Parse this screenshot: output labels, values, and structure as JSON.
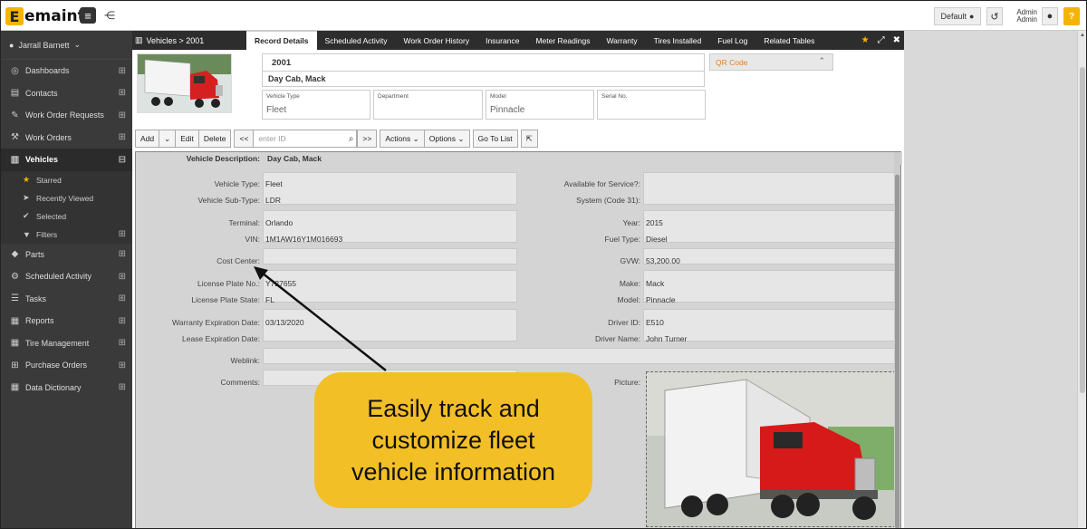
{
  "app": {
    "logo_text": "emaint",
    "logo_mark": "E"
  },
  "topbar": {
    "default_label": "Default",
    "admin_line1": "Admin",
    "admin_line2": "Admin",
    "help": "?"
  },
  "sidebar": {
    "user": "Jarrall Barnett",
    "items": [
      {
        "label": "Dashboards",
        "icon": "dashboard-icon",
        "glyph": "◎"
      },
      {
        "label": "Contacts",
        "icon": "contacts-icon",
        "glyph": "▤"
      },
      {
        "label": "Work Order Requests",
        "icon": "wrench-icon",
        "glyph": "✎"
      },
      {
        "label": "Work Orders",
        "icon": "wrench-icon",
        "glyph": "⚒"
      },
      {
        "label": "Vehicles",
        "icon": "vehicles-icon",
        "glyph": "▥"
      }
    ],
    "sub_items": [
      {
        "label": "Starred",
        "icon": "star-icon",
        "glyph": "★"
      },
      {
        "label": "Recently Viewed",
        "icon": "send-icon",
        "glyph": "➤"
      },
      {
        "label": "Selected",
        "icon": "check-icon",
        "glyph": "✔"
      },
      {
        "label": "Filters",
        "icon": "filter-icon",
        "glyph": "▼"
      }
    ],
    "items2": [
      {
        "label": "Parts",
        "icon": "tag-icon",
        "glyph": "◆"
      },
      {
        "label": "Scheduled Activity",
        "icon": "gears-icon",
        "glyph": "⚙"
      },
      {
        "label": "Tasks",
        "icon": "tasks-icon",
        "glyph": "☰"
      },
      {
        "label": "Reports",
        "icon": "chart-icon",
        "glyph": "▦"
      },
      {
        "label": "Tire Management",
        "icon": "table-icon",
        "glyph": "▦"
      },
      {
        "label": "Purchase Orders",
        "icon": "cart-icon",
        "glyph": "⊞"
      },
      {
        "label": "Data Dictionary",
        "icon": "table-icon",
        "glyph": "▦"
      }
    ]
  },
  "tabbar": {
    "breadcrumb": "Vehicles > 2001",
    "tabs": [
      "Record Details",
      "Scheduled Activity",
      "Work Order History",
      "Insurance",
      "Meter Readings",
      "Warranty",
      "Tires Installed",
      "Fuel Log",
      "Related Tables"
    ]
  },
  "header": {
    "id": "2001",
    "name": "Day Cab, Mack",
    "qr": "QR Code",
    "fields": [
      {
        "label": "Vehicle Type",
        "value": "Fleet"
      },
      {
        "label": "Department",
        "value": ""
      },
      {
        "label": "Model",
        "value": "Pinnacle"
      },
      {
        "label": "Serial No.",
        "value": ""
      }
    ]
  },
  "toolbar": {
    "add": "Add",
    "edit": "Edit",
    "delete": "Delete",
    "prev": "<<",
    "search_placeholder": "enter ID",
    "next": ">>",
    "actions": "Actions",
    "options": "Options",
    "goto": "Go To List"
  },
  "form": {
    "description_label": "Vehicle Description:",
    "description_value": "Day Cab, Mack",
    "left": [
      {
        "label": "Vehicle Type:",
        "value": "Fleet"
      },
      {
        "label": "Vehicle Sub-Type:",
        "value": "LDR"
      },
      {
        "label": "Terminal:",
        "value": "Orlando"
      },
      {
        "label": "VIN:",
        "value": "1M1AW16Y1M016693"
      },
      {
        "label": "Cost Center:",
        "value": ""
      },
      {
        "label": "License Plate No.:",
        "value": "Y727655"
      },
      {
        "label": "License Plate State:",
        "value": "FL"
      },
      {
        "label": "Warranty Expiration Date:",
        "value": "03/13/2020"
      },
      {
        "label": "Lease Expiration Date:",
        "value": ""
      },
      {
        "label": "Weblink:",
        "value": ""
      },
      {
        "label": "Comments:",
        "value": ""
      }
    ],
    "right": [
      {
        "label": "Available for Service?:",
        "value": ""
      },
      {
        "label": "System (Code 31):",
        "value": ""
      },
      {
        "label": "Year:",
        "value": "2015"
      },
      {
        "label": "Fuel Type:",
        "value": "Diesel"
      },
      {
        "label": "GVW:",
        "value": "53,200.00"
      },
      {
        "label": "Make:",
        "value": "Mack"
      },
      {
        "label": "Model:",
        "value": "Pinnacle"
      },
      {
        "label": "Driver ID:",
        "value": "E510"
      },
      {
        "label": "Driver Name:",
        "value": "John Turner"
      },
      {
        "label": "Picture:",
        "value": ""
      }
    ]
  },
  "callout": {
    "text": "Easily track and customize fleet vehicle information",
    "color": "#f2bf26"
  }
}
